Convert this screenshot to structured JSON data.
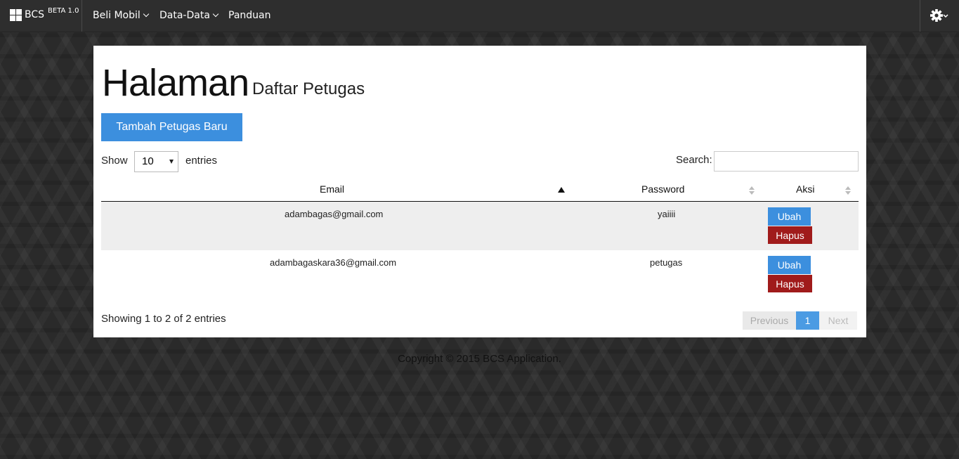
{
  "navbar": {
    "brand": "BCS",
    "version": "BETA 1.0",
    "menu": [
      {
        "label": "Beli Mobil",
        "dropdown": true
      },
      {
        "label": "Data-Data",
        "dropdown": true
      },
      {
        "label": "Panduan",
        "dropdown": false
      }
    ],
    "settings_icon": "gear-icon"
  },
  "page": {
    "title": "Halaman",
    "subtitle": "Daftar Petugas",
    "add_button": "Tambah Petugas Baru"
  },
  "table_controls": {
    "show_label": "Show",
    "page_length": "10",
    "entries_label": "entries",
    "search_label": "Search:",
    "search_value": ""
  },
  "table": {
    "columns": [
      {
        "label": "Email",
        "sort": "ascending"
      },
      {
        "label": "Password",
        "sort": "none"
      },
      {
        "label": "Aksi",
        "sort": "none"
      }
    ],
    "rows": [
      {
        "email": "adambagas@gmail.com",
        "password": "yaiiii",
        "edit": "Ubah",
        "delete": "Hapus"
      },
      {
        "email": "adambagaskara36@gmail.com",
        "password": "petugas",
        "edit": "Ubah",
        "delete": "Hapus"
      }
    ]
  },
  "pagination": {
    "info": "Showing 1 to 2 of 2 entries",
    "previous": "Previous",
    "current": "1",
    "next": "Next"
  },
  "footer": {
    "copyright": "Copyright © 2015 BCS Application."
  },
  "colors": {
    "primary": "#3c8fde",
    "danger": "#a01b1b",
    "navbar": "#2e2e2e"
  }
}
